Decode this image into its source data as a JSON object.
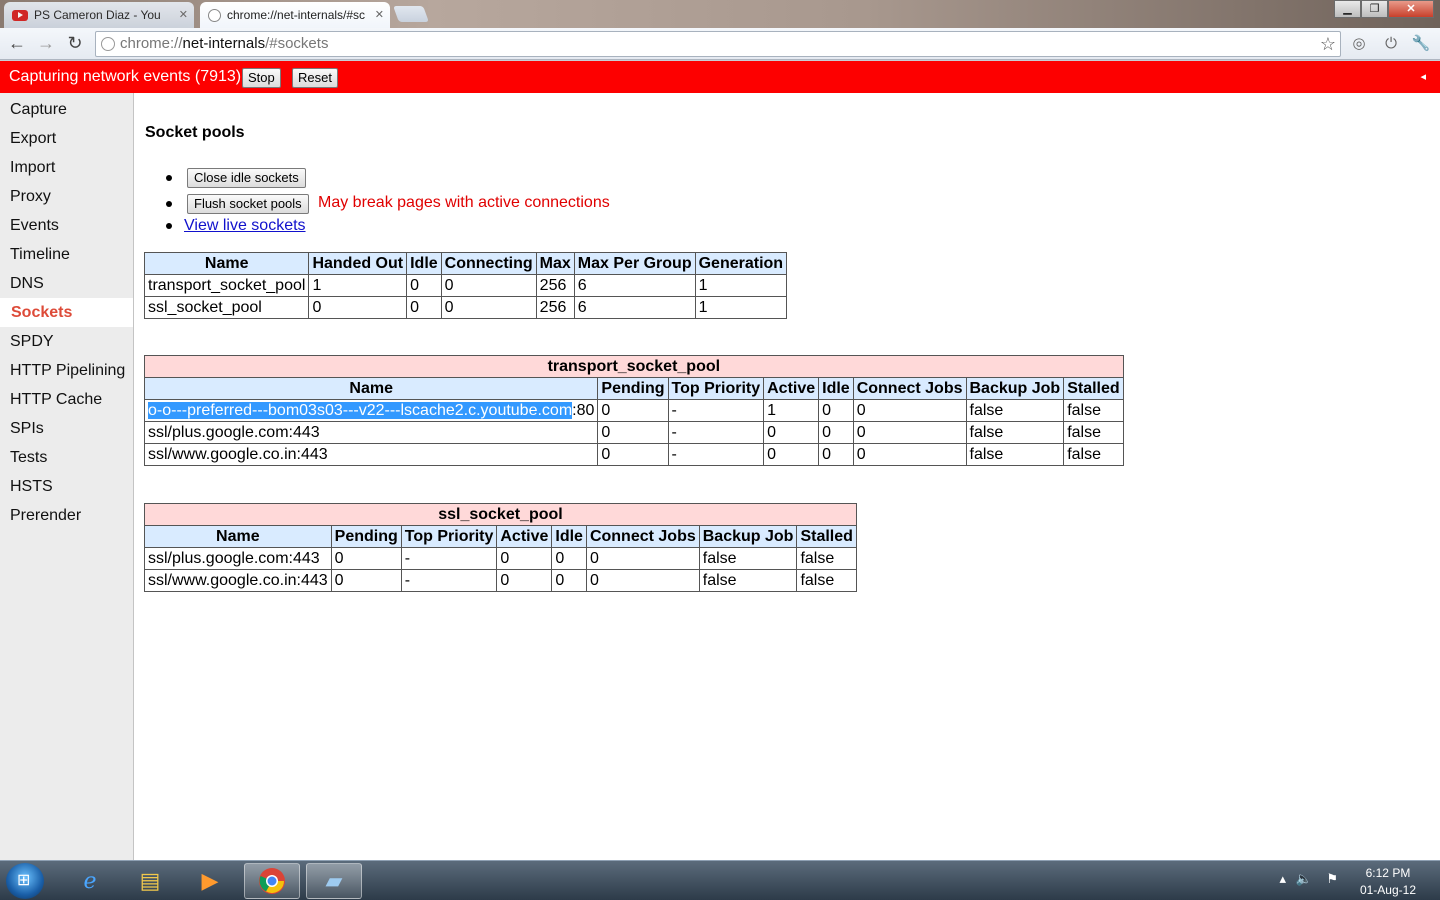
{
  "window": {
    "tabs": [
      {
        "label": "PS Cameron Diaz - You",
        "icon": "youtube-icon"
      },
      {
        "label": "chrome://net-internals/#sc",
        "icon": "page-icon"
      }
    ],
    "controls": {
      "minimize": "▁",
      "maximize": "❐",
      "close": "✕"
    }
  },
  "toolbar": {
    "url_prefix": "chrome://",
    "url_host": "net-internals",
    "url_path": "/#sockets"
  },
  "capture": {
    "status": "Capturing network events (7913)",
    "stop_label": "Stop",
    "reset_label": "Reset",
    "collapse_glyph": "◂"
  },
  "sidebar": {
    "items": [
      {
        "label": "Capture"
      },
      {
        "label": "Export"
      },
      {
        "label": "Import"
      },
      {
        "label": "Proxy"
      },
      {
        "label": "Events"
      },
      {
        "label": "Timeline"
      },
      {
        "label": "DNS"
      },
      {
        "label": "Sockets"
      },
      {
        "label": "SPDY"
      },
      {
        "label": "HTTP Pipelining"
      },
      {
        "label": "HTTP Cache"
      },
      {
        "label": "SPIs"
      },
      {
        "label": "Tests"
      },
      {
        "label": "HSTS"
      },
      {
        "label": "Prerender"
      }
    ],
    "selected": "Sockets"
  },
  "main": {
    "heading": "Socket pools",
    "close_idle_label": "Close idle sockets",
    "flush_label": "Flush socket pools",
    "flush_warning": "May break pages with active connections",
    "live_link": "View live sockets",
    "pools_table": {
      "headers": [
        "Name",
        "Handed Out",
        "Idle",
        "Connecting",
        "Max",
        "Max Per Group",
        "Generation"
      ],
      "rows": [
        [
          "transport_socket_pool",
          "1",
          "0",
          "0",
          "256",
          "6",
          "1"
        ],
        [
          "ssl_socket_pool",
          "0",
          "0",
          "0",
          "256",
          "6",
          "1"
        ]
      ]
    },
    "transport_table": {
      "caption": "transport_socket_pool",
      "headers": [
        "Name",
        "Pending",
        "Top Priority",
        "Active",
        "Idle",
        "Connect Jobs",
        "Backup Job",
        "Stalled"
      ],
      "first_row_selected": "o-o---preferred---bom03s03---v22---lscache2.c.youtube.com",
      "first_row_rest": ":80",
      "first_row_values": [
        "0",
        "-",
        "1",
        "0",
        "0",
        "false",
        "false"
      ],
      "rows": [
        [
          "ssl/plus.google.com:443",
          "0",
          "-",
          "0",
          "0",
          "0",
          "false",
          "false"
        ],
        [
          "ssl/www.google.co.in:443",
          "0",
          "-",
          "0",
          "0",
          "0",
          "false",
          "false"
        ]
      ]
    },
    "ssl_table": {
      "caption": "ssl_socket_pool",
      "headers": [
        "Name",
        "Pending",
        "Top Priority",
        "Active",
        "Idle",
        "Connect Jobs",
        "Backup Job",
        "Stalled"
      ],
      "rows": [
        [
          "ssl/plus.google.com:443",
          "0",
          "-",
          "0",
          "0",
          "0",
          "false",
          "false"
        ],
        [
          "ssl/www.google.co.in:443",
          "0",
          "-",
          "0",
          "0",
          "0",
          "false",
          "false"
        ]
      ]
    }
  },
  "taskbar": {
    "time": "6:12 PM",
    "date": "01-Aug-12"
  }
}
